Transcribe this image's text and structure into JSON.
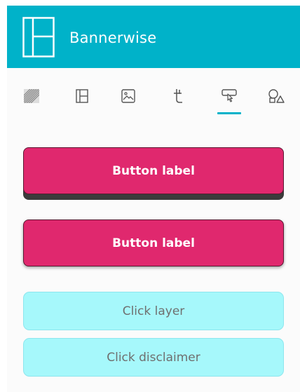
{
  "header": {
    "brand": "Bannerwise",
    "logo_icon": "layout-logo-icon",
    "background": "#00b2c9"
  },
  "toolbar": {
    "tools": [
      {
        "icon": "texture-icon"
      },
      {
        "icon": "layout-icon"
      },
      {
        "icon": "image-icon"
      },
      {
        "icon": "text-icon"
      },
      {
        "icon": "button-click-icon",
        "active": true
      },
      {
        "icon": "shapes-icon"
      }
    ],
    "accent": "#00b2c9"
  },
  "buttons": {
    "button_a_label": "Button label",
    "button_b_label": "Button label",
    "click_layer_label": "Click layer",
    "click_disclaimer_label": "Click disclaimer",
    "primary_color": "#e0286e",
    "light_color": "#a6f8fb"
  }
}
